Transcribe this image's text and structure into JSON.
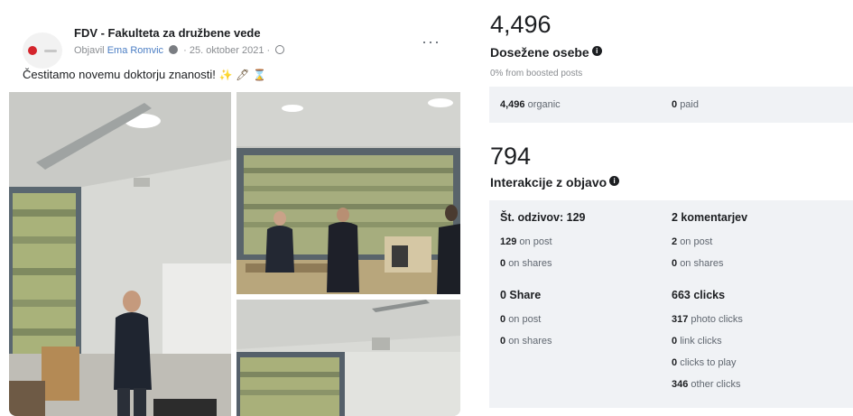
{
  "post": {
    "page_name": "FDV - Fakulteta za družbene vede",
    "meta_prefix": "Objavil",
    "author": "Ema Romvic",
    "meta_separator": "·",
    "date": "25. oktober 2021",
    "more_label": "···",
    "text": "Čestitamo novemu doktorju znanosti!",
    "emojis": [
      "✨",
      "🖊",
      "⌛"
    ],
    "photos": [
      "lecturer-standing-in-classroom-photo",
      "two-people-at-front-of-classroom-photo",
      "classroom-ceiling-and-window-photo"
    ]
  },
  "reach": {
    "value": "4,496",
    "title": "Dosežene osebe",
    "note": "0% from boosted posts",
    "organic_num": "4,496",
    "organic_label": "organic",
    "paid_num": "0",
    "paid_label": "paid"
  },
  "interactions": {
    "value": "794",
    "title": "Interakcije z objavo",
    "reactions": {
      "head": "Št. odzivov: 129",
      "on_post_num": "129",
      "on_post_label": "on post",
      "on_shares_num": "0",
      "on_shares_label": "on shares"
    },
    "comments": {
      "head": "2 komentarjev",
      "on_post_num": "2",
      "on_post_label": "on post",
      "on_shares_num": "0",
      "on_shares_label": "on shares"
    },
    "shares": {
      "head": "0 Share",
      "on_post_num": "0",
      "on_post_label": "on post",
      "on_shares_num": "0",
      "on_shares_label": "on shares"
    },
    "clicks": {
      "head": "663 clicks",
      "photo_num": "317",
      "photo_label": "photo clicks",
      "link_num": "0",
      "link_label": "link clicks",
      "play_num": "0",
      "play_label": "clicks to play",
      "other_num": "346",
      "other_label": "other clicks"
    }
  },
  "colors": {
    "brand_red": "#d4252c",
    "link_blue": "#4a7dc4",
    "panel_gray": "#f0f2f5"
  }
}
